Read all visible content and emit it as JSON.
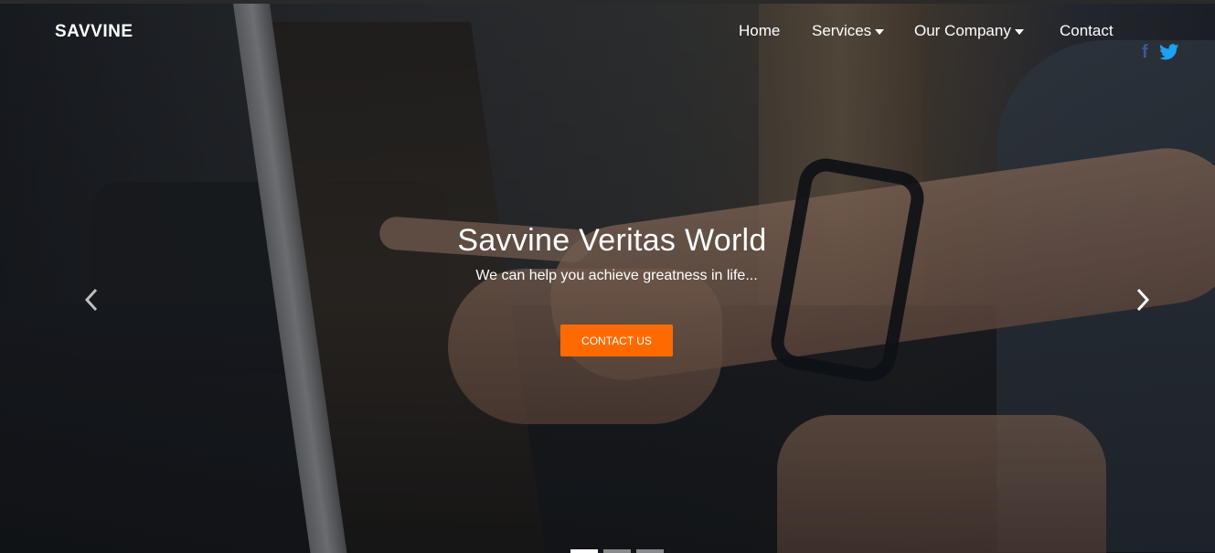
{
  "brand": {
    "name": "SAVVINE"
  },
  "nav": {
    "items": [
      {
        "label": "Home",
        "has_dropdown": false
      },
      {
        "label": "Services",
        "has_dropdown": true
      },
      {
        "label": "Our Company",
        "has_dropdown": true
      },
      {
        "label": "Contact",
        "has_dropdown": false
      }
    ],
    "social": [
      {
        "icon": "facebook-icon",
        "glyph": "f",
        "color": "#3b5998"
      },
      {
        "icon": "twitter-icon",
        "glyph": "bird",
        "color": "#1da1f2"
      }
    ]
  },
  "hero": {
    "title": "Savvine Veritas World",
    "subtitle": "We can help you achieve greatness in life...",
    "cta_label": "CONTACT US",
    "cta_color": "#ff6a00"
  },
  "carousel": {
    "prev_icon": "chevron-left-icon",
    "next_icon": "chevron-right-icon",
    "active_index": 0,
    "slide_count": 3
  }
}
